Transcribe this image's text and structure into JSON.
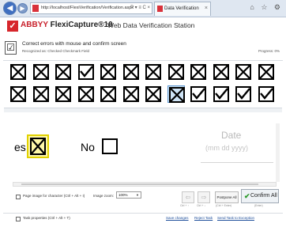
{
  "browser": {
    "address": "http://localhost/FlexiVerification/Verification.aspx",
    "address_tools": "P ▾ ≡ C ×",
    "tab_title": "Data Verification",
    "tab_close": "×",
    "back_glyph": "◀",
    "forward_glyph": "▶",
    "window_tools": "⌂ ☆ ⚙"
  },
  "app": {
    "logo_glyph": "✓",
    "brand": "ABBYY",
    "product": "FlexiCapture",
    "version": "®10",
    "station": "Web Data Verification Station"
  },
  "task": {
    "icon_glyph": "☑",
    "title": "Correct errors with mouse and confirm screen",
    "subtitle": "Recognized as: Checked Checkmark Field",
    "progress": "Progress: 0%"
  },
  "character_grid": {
    "row1": [
      {
        "mark": "cross"
      },
      {
        "mark": "cross"
      },
      {
        "mark": "cross"
      },
      {
        "mark": "tick"
      },
      {
        "mark": "cross"
      },
      {
        "mark": "cross"
      },
      {
        "mark": "cross"
      },
      {
        "mark": "cross"
      },
      {
        "mark": "cross"
      },
      {
        "mark": "cross"
      },
      {
        "mark": "cross"
      },
      {
        "mark": "cross"
      }
    ],
    "row2": [
      {
        "mark": "cross"
      },
      {
        "mark": "cross"
      },
      {
        "mark": "cross"
      },
      {
        "mark": "cross"
      },
      {
        "mark": "cross"
      },
      {
        "mark": "cross"
      },
      {
        "mark": "cross"
      },
      {
        "mark": "cross",
        "selected": true
      },
      {
        "mark": "tick"
      },
      {
        "mark": "tick"
      },
      {
        "mark": "tick"
      },
      {
        "mark": "tick"
      }
    ]
  },
  "field_image": {
    "yes_fragment": "es",
    "no_label": "No",
    "date_label": "Date",
    "date_hint": "(mm dd yyyy)"
  },
  "toolbar": {
    "page_image_label": "Page image for character",
    "page_image_hotkey": "(Ctrl + Alt + I)",
    "image_zoom_label": "Image zoom:",
    "image_zoom_value": "100%",
    "prev_glyph": "⇦",
    "next_glyph": "⇨",
    "prev_hotkey": "Ctrl + ↑",
    "next_hotkey": "Ctrl + ↓",
    "postpone_label": "Postpone All",
    "postpone_hotkey": "(Ctrl + Enter)",
    "confirm_label": "Confirm All",
    "confirm_glyph": "✔",
    "confirm_hotkey": "(Enter)"
  },
  "footer": {
    "task_properties": "Task properties",
    "task_properties_hotkey": "(Ctrl + Alt + T)",
    "save_changes": "Save changes",
    "reject_task": "Reject Task",
    "send_to_exception": "Send Task to Exception"
  },
  "colors": {
    "brand_red": "#c8202b",
    "selected_cell": "#cfe4f6",
    "field_highlight": "#fff8a8",
    "confirm_green": "#2d9b2d"
  }
}
